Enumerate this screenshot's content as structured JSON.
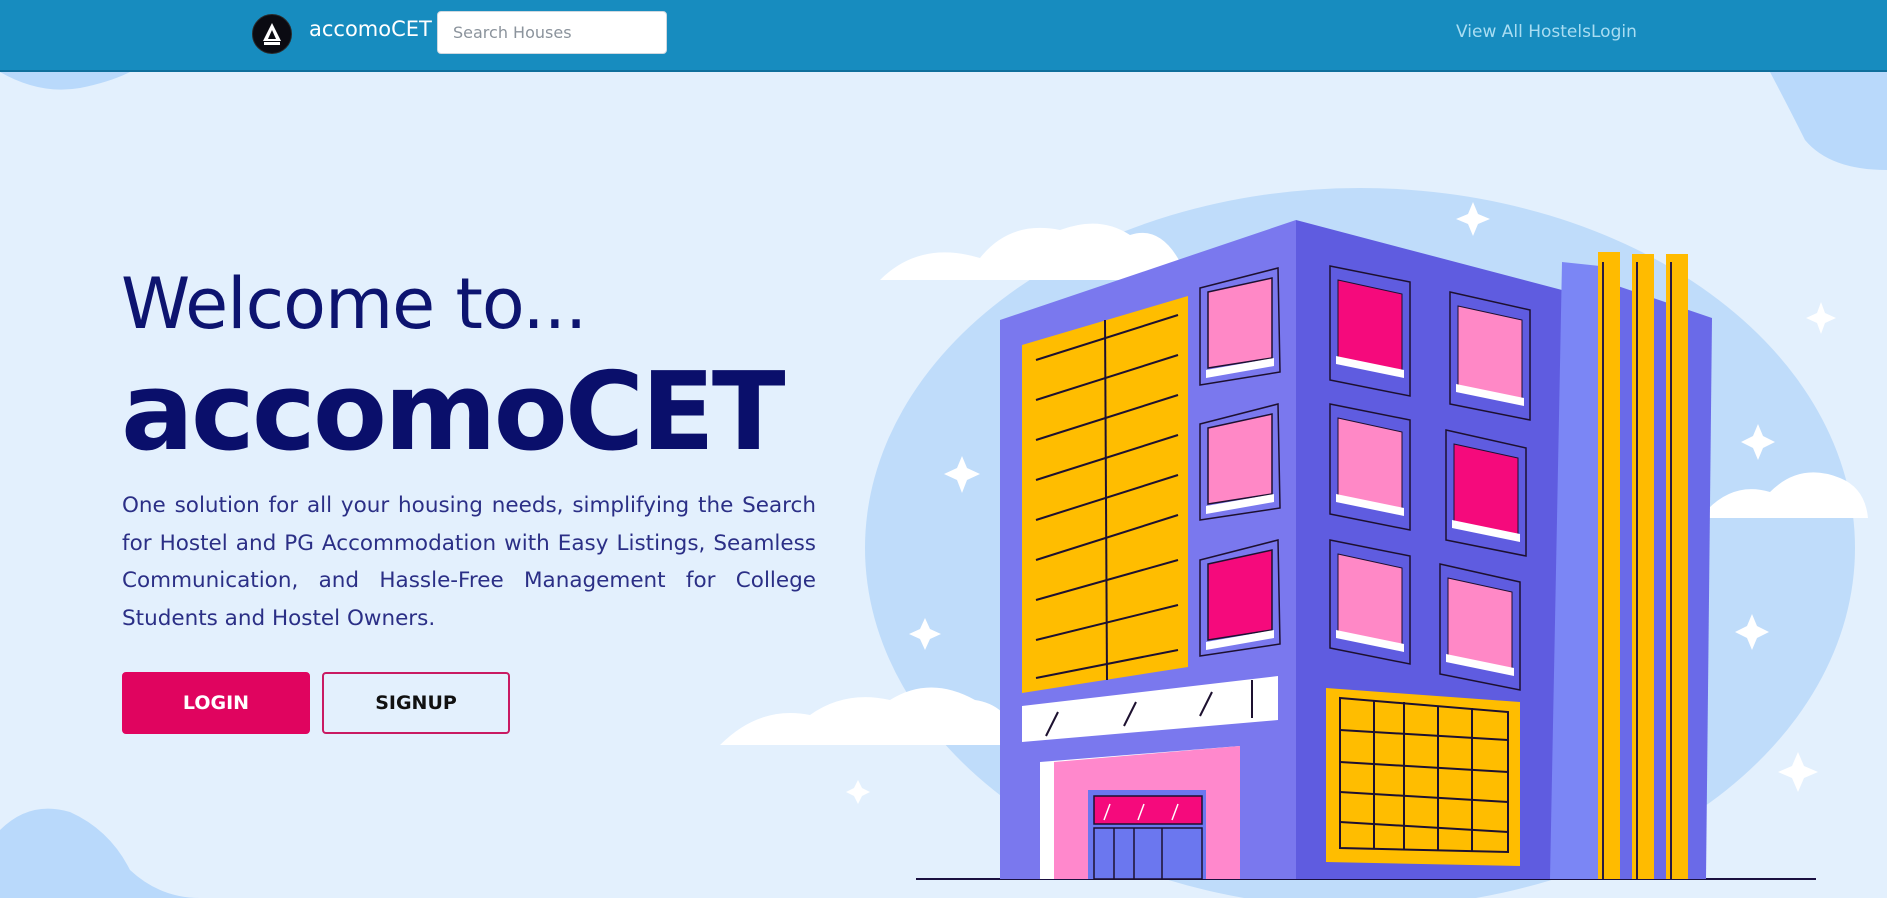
{
  "navbar": {
    "brand": "accomoCET",
    "search_placeholder": "Search Houses",
    "links": {
      "view_all_hostels": "View All Hostels",
      "login": "Login"
    }
  },
  "hero": {
    "welcome": "Welcome to...",
    "title": "accomoCET",
    "description": "One solution for all your housing needs, simplifying the Search for Hostel and PG Accommodation with Easy Listings, Seamless Communication, and Hassle-Free Management for College Students and Hostel Owners.",
    "login_button": "LOGIN",
    "signup_button": "SIGNUP"
  },
  "colors": {
    "navbar": "#178cbf",
    "background": "#e3f0fd",
    "accent": "#e0045f",
    "heading": "#0a0f6b"
  },
  "icons": [
    "accomocet-logo-icon",
    "hostel-building-illustration"
  ]
}
